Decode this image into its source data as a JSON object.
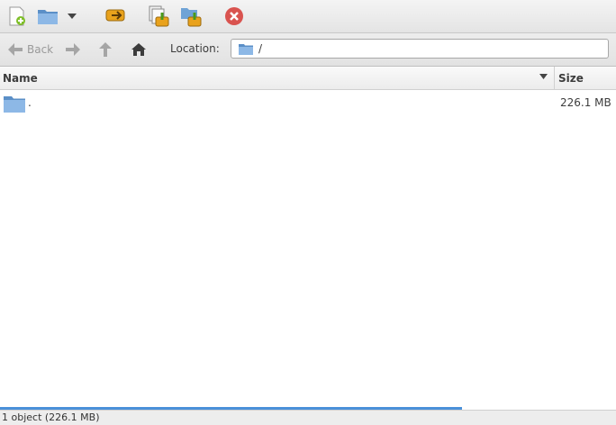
{
  "toolbar": {
    "buttons": [
      {
        "icon": "new-archive-icon"
      },
      {
        "icon": "open-archive-icon"
      },
      {
        "icon": "open-dropdown-icon"
      },
      {
        "icon": "extract-icon"
      },
      {
        "icon": "add-files-icon"
      },
      {
        "icon": "add-folder-icon"
      },
      {
        "icon": "stop-icon"
      }
    ]
  },
  "nav": {
    "back_label": "Back",
    "location_label": "Location:",
    "location_value": "/"
  },
  "columns": {
    "name": "Name",
    "size": "Size"
  },
  "rows": [
    {
      "name": ".",
      "size": "226.1 MB",
      "icon": "folder-icon"
    }
  ],
  "status": {
    "text": "1 object (226.1 MB)",
    "progress_fraction": 0.75
  },
  "colors": {
    "accent": "#4a90d9",
    "folder": "#6fa3d6",
    "stop": "#d9534f"
  }
}
